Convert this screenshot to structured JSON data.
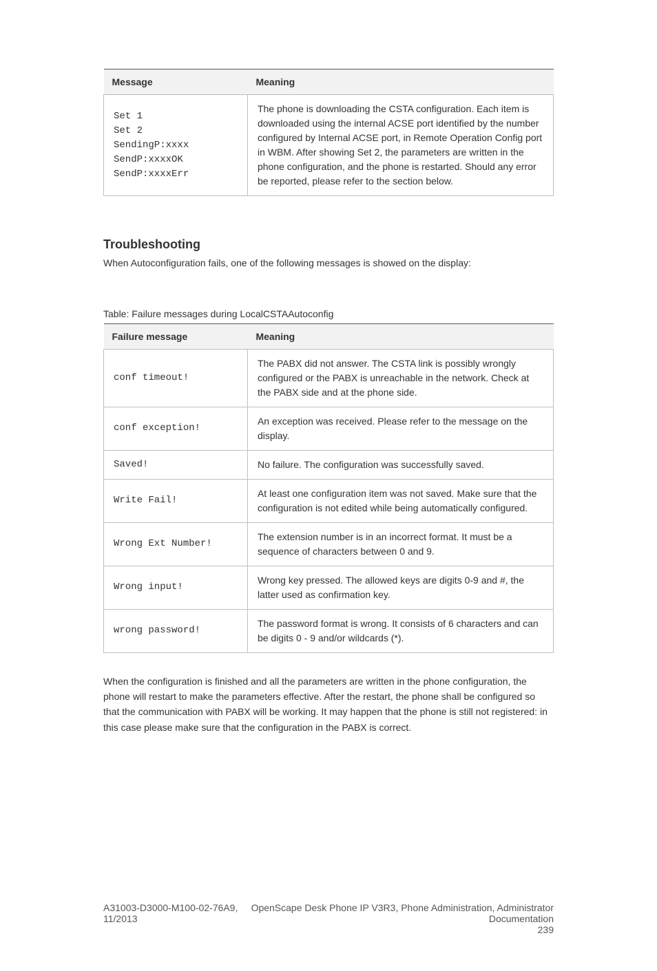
{
  "table1": {
    "headers": {
      "msg": "Message",
      "desc": "Meaning"
    },
    "row": {
      "msg_line1": "Set 1",
      "msg_line2": "Set 2",
      "msg_line3": "SendingP:xxxx",
      "msg_line4": "SendP:xxxxOK",
      "msg_line5": "SendP:xxxxErr",
      "desc": "The phone is downloading the CSTA configuration. Each item is downloaded using the internal ACSE port identified by the number configured by Internal ACSE port, in Remote Operation Config port in WBM. After showing Set 2, the parameters are written in the phone configuration, and the phone is restarted. Should any error be reported, please refer to the section below."
    }
  },
  "troubleshooting": {
    "heading": "Troubleshooting",
    "desc": "When Autoconfiguration fails, one of the following messages is showed on the display:"
  },
  "table2": {
    "caption": "Table: Failure messages during LocalCSTAAutoconfig",
    "headers": {
      "msg": "Failure message",
      "desc": "Meaning"
    },
    "rows": [
      {
        "msg": "conf timeout!",
        "desc": "The PABX did not answer. The CSTA link is possibly wrongly configured or the PABX is unreachable in the network. Check at the PABX side and at the phone side."
      },
      {
        "msg": "conf exception!",
        "desc": "An exception was received. Please refer to the message on the display."
      },
      {
        "msg": "Saved!",
        "desc": "No failure. The configuration was successfully saved."
      },
      {
        "msg": "Write Fail!",
        "desc": "At least one configuration item was not saved. Make sure that the configuration is not edited while being automatically configured."
      },
      {
        "msg": "Wrong Ext Number!",
        "desc": "The extension number is in an incorrect format. It must be a sequence of characters between 0 and 9."
      },
      {
        "msg": "Wrong input!",
        "desc": "Wrong key pressed. The allowed keys are digits 0-9 and #, the latter used as confirmation key."
      },
      {
        "msg": "wrong password!",
        "desc": "The password format is wrong. It consists of 6 characters and can be digits 0 - 9 and/or wildcards (*)."
      }
    ]
  },
  "after": "When the configuration is finished and all the parameters are written in the phone configuration, the phone will restart to make the parameters effective. After the restart, the phone shall be configured so that the communication with PABX will be working. It may happen that the phone is still not registered: in this case please make sure that the configuration in the PABX is correct.",
  "footer": {
    "left": "A31003-D3000-M100-02-76A9, 11/2013",
    "right_line1": "OpenScape Desk Phone IP V3R3, Phone Administration, Administrator Documentation",
    "right_page": "239"
  }
}
